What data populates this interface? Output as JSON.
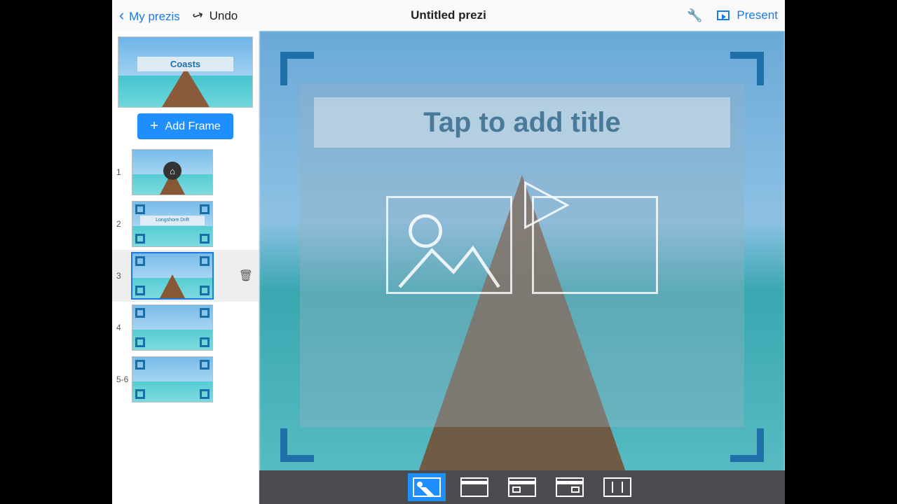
{
  "toolbar": {
    "back_label": "My prezis",
    "undo_label": "Undo",
    "title": "Untitled prezi",
    "present_label": "Present"
  },
  "sidebar": {
    "overview_title": "Coasts",
    "add_frame_label": "Add Frame",
    "frames": [
      {
        "num": "1",
        "label": ""
      },
      {
        "num": "2",
        "label": "Longshore Drift"
      },
      {
        "num": "3",
        "label": "",
        "selected": true
      },
      {
        "num": "4",
        "label": ""
      },
      {
        "num": "5-6",
        "label": ""
      }
    ]
  },
  "canvas": {
    "title_placeholder": "Tap to add title"
  },
  "bottom_tools": [
    "layout-picture",
    "layout-header",
    "layout-header-image",
    "layout-corner",
    "layout-columns"
  ]
}
